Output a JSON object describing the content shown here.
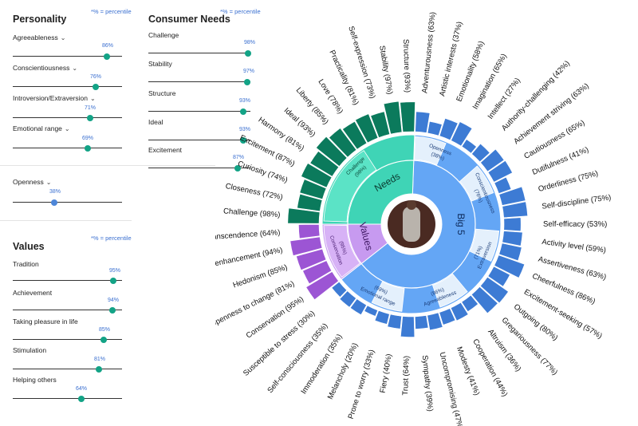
{
  "percentile_note": "*% = percentile",
  "personality": {
    "title": "Personality",
    "items": [
      {
        "label": "Agreeableness",
        "value": "86%",
        "level": 0.86
      },
      {
        "label": "Conscientiousness",
        "value": "76%",
        "level": 0.76
      },
      {
        "label": "Introversion/Extraversion",
        "value": "71%",
        "level": 0.71
      },
      {
        "label": "Emotional range",
        "value": "69%",
        "level": 0.69
      }
    ],
    "openness": {
      "label": "Openness",
      "value": "38%",
      "level": 0.38
    }
  },
  "needs": {
    "title": "Consumer Needs",
    "items": [
      {
        "label": "Challenge",
        "value": "98%",
        "level": 0.98
      },
      {
        "label": "Stability",
        "value": "97%",
        "level": 0.97
      },
      {
        "label": "Structure",
        "value": "93%",
        "level": 0.93
      },
      {
        "label": "Ideal",
        "value": "93%",
        "level": 0.93
      },
      {
        "label": "Excitement",
        "value": "87%",
        "level": 0.87
      }
    ]
  },
  "values": {
    "title": "Values",
    "items": [
      {
        "label": "Tradition",
        "value": "95%",
        "level": 0.95
      },
      {
        "label": "Achievement",
        "value": "94%",
        "level": 0.94
      },
      {
        "label": "Taking pleasure in life",
        "value": "85%",
        "level": 0.85
      },
      {
        "label": "Stimulation",
        "value": "81%",
        "level": 0.81
      },
      {
        "label": "Helping others",
        "value": "64%",
        "level": 0.64
      }
    ]
  },
  "colors": {
    "needs_dark": "#0b7a5c",
    "needs_light": "#3fd4b6",
    "values_dark": "#9c55d4",
    "values_light": "#c79af0",
    "big5_dark": "#3d7bd4",
    "big5_mid": "#64a6f5",
    "big5_pale": "#e4f0fc",
    "slider_green": "#13a386",
    "slider_blue": "#4d86d8",
    "note_blue": "#3a6fd0"
  },
  "chart_data": {
    "type": "sunburst",
    "center_image": "portrait-photo",
    "groups": [
      {
        "name": "Big 5",
        "value": null
      },
      {
        "name": "Needs",
        "value": null
      },
      {
        "name": "Values",
        "value": null
      }
    ],
    "traits": [
      {
        "name": "Openness",
        "value": "(38%)",
        "group": "Big 5"
      },
      {
        "name": "Conscientiousness",
        "value": "(76%)",
        "group": "Big 5"
      },
      {
        "name": "Extraversion",
        "value": "(71%)",
        "group": "Big 5"
      },
      {
        "name": "Agreeableness",
        "value": "(86%)",
        "group": "Big 5"
      },
      {
        "name": "Emotional range",
        "value": "(69%)",
        "group": "Big 5"
      },
      {
        "name": "Challenge",
        "value": "(98%)",
        "group": "Needs"
      },
      {
        "name": "Conservation",
        "value": "(95%)",
        "group": "Values"
      }
    ],
    "facets": [
      {
        "label": "Adventurousness (63%)",
        "value": 63
      },
      {
        "label": "Artistic interests (37%)",
        "value": 37
      },
      {
        "label": "Emotionality (58%)",
        "value": 58
      },
      {
        "label": "Imagination (65%)",
        "value": 65
      },
      {
        "label": "Intellect (27%)",
        "value": 27
      },
      {
        "label": "Authority-challenging (42%)",
        "value": 42
      },
      {
        "label": "Achievement striving (63%)",
        "value": 63
      },
      {
        "label": "Cautiousness (65%)",
        "value": 65
      },
      {
        "label": "Dutifulness (41%)",
        "value": 41
      },
      {
        "label": "Orderliness (75%)",
        "value": 75
      },
      {
        "label": "Self-discipline (75%)",
        "value": 75
      },
      {
        "label": "Self-efficacy (53%)",
        "value": 53
      },
      {
        "label": "Activity level (59%)",
        "value": 59
      },
      {
        "label": "Assertiveness (63%)",
        "value": 63
      },
      {
        "label": "Cheerfulness (86%)",
        "value": 86
      },
      {
        "label": "Excitement-seeking (57%)",
        "value": 57
      },
      {
        "label": "Outgoing (80%)",
        "value": 80
      },
      {
        "label": "Gregariousness (77%)",
        "value": 77
      },
      {
        "label": "Altruism (36%)",
        "value": 36
      },
      {
        "label": "Cooperation (44%)",
        "value": 44
      },
      {
        "label": "Modesty (41%)",
        "value": 41
      },
      {
        "label": "Uncompromising (47%)",
        "value": 47
      },
      {
        "label": "Sympathy (39%)",
        "value": 39
      },
      {
        "label": "Trust (64%)",
        "value": 64
      },
      {
        "label": "Fiery (40%)",
        "value": 40
      },
      {
        "label": "Prone to worry (33%)",
        "value": 33
      },
      {
        "label": "Melancholy (20%)",
        "value": 20
      },
      {
        "label": "Immoderation (35%)",
        "value": 35
      },
      {
        "label": "Self-consciousness (35%)",
        "value": 35
      },
      {
        "label": "Susceptible to stress (30%)",
        "value": 30
      },
      {
        "label": "Conservation (95%)",
        "value": 95
      },
      {
        "label": "Openness to change (81%)",
        "value": 81
      },
      {
        "label": "Hedonism (85%)",
        "value": 85
      },
      {
        "label": "Self-enhancement (94%)",
        "value": 94
      },
      {
        "label": "Self-transcendence (64%)",
        "value": 64
      },
      {
        "label": "Challenge (98%)",
        "value": 98
      },
      {
        "label": "Closeness (72%)",
        "value": 72
      },
      {
        "label": "Curiosity (74%)",
        "value": 74
      },
      {
        "label": "Excitement (87%)",
        "value": 87
      },
      {
        "label": "Harmony (81%)",
        "value": 81
      },
      {
        "label": "Ideal (93%)",
        "value": 93
      },
      {
        "label": "Liberty (85%)",
        "value": 85
      },
      {
        "label": "Love (78%)",
        "value": 78
      },
      {
        "label": "Practicality (81%)",
        "value": 81
      },
      {
        "label": "Self-expression (73%)",
        "value": 73
      },
      {
        "label": "Stability (97%)",
        "value": 97
      },
      {
        "label": "Structure (93%)",
        "value": 93
      }
    ]
  }
}
